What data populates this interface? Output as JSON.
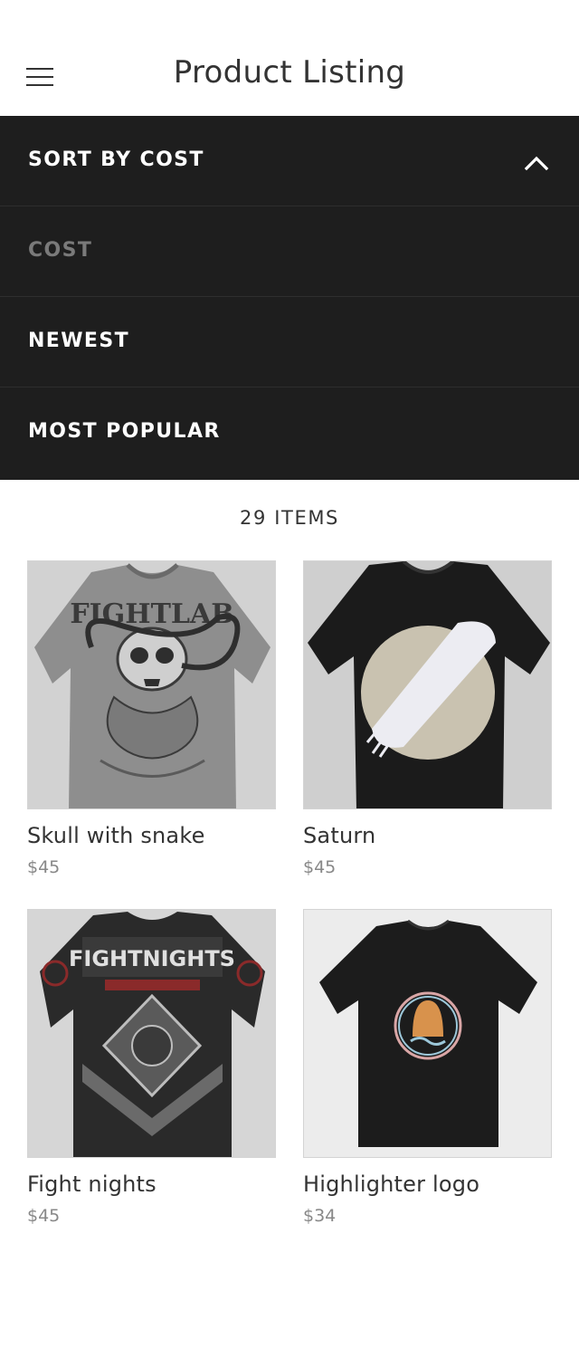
{
  "header": {
    "title": "Product Listing",
    "menu_icon": "hamburger-menu-icon"
  },
  "sort": {
    "heading": "SORT BY COST",
    "toggle_icon": "chevron-up-icon",
    "options": [
      {
        "label": "COST",
        "state": "selected-disabled"
      },
      {
        "label": "NEWEST"
      },
      {
        "label": "MOST POPULAR"
      }
    ]
  },
  "listing": {
    "count_label": "29 ITEMS"
  },
  "products": [
    {
      "name": "Skull with snake",
      "price": "$45",
      "image": "grey t-shirt with skull and snake graphic"
    },
    {
      "name": "Saturn",
      "price": "$45",
      "image": "black t-shirt with beige circle and white brush stroke"
    },
    {
      "name": "Fight nights",
      "price": "$45",
      "image": "black t-shirt with FIGHT NIGHTS print"
    },
    {
      "name": "Highlighter logo",
      "price": "$34",
      "image": "black t-shirt with circular logo"
    }
  ],
  "colors": {
    "panel_bg": "#1e1e1e",
    "panel_text": "#ffffff",
    "disabled_text": "#7a7a7a",
    "price_text": "#888888"
  }
}
